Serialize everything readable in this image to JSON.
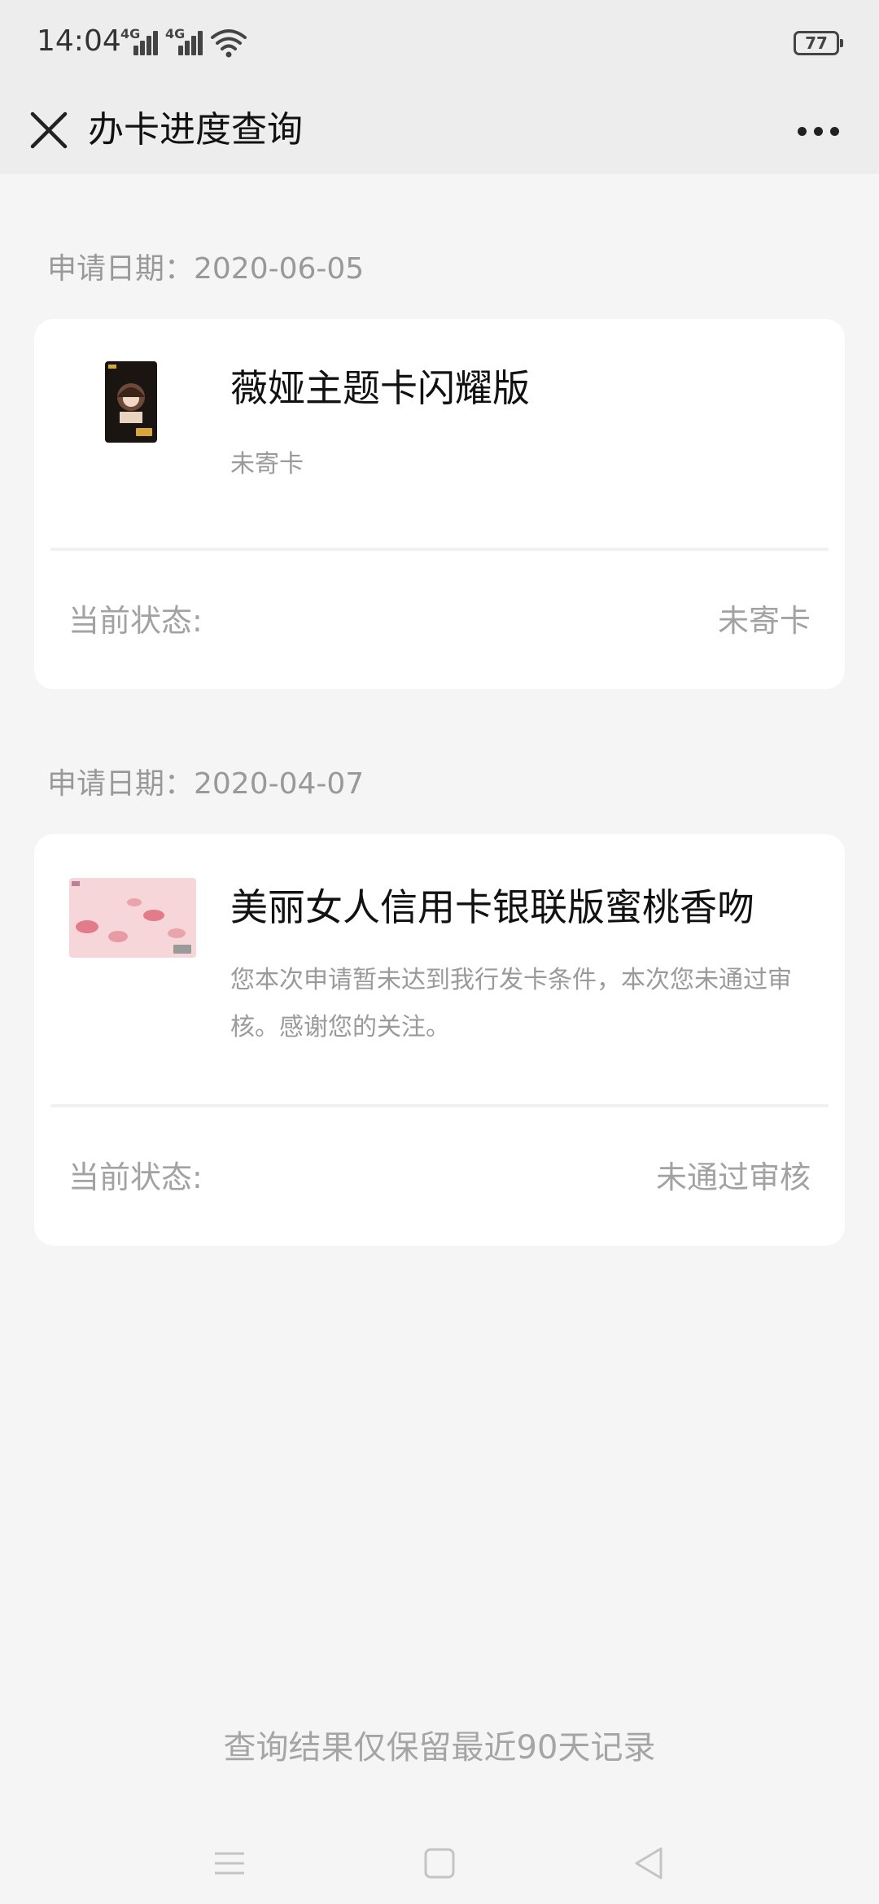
{
  "status_bar": {
    "time": "14:04",
    "network_1": "4G",
    "network_2": "4G",
    "battery": "77",
    "icons": [
      "signal-icon",
      "signal-icon",
      "wifi-icon",
      "battery-icon"
    ]
  },
  "header": {
    "title": "办卡进度查询",
    "close_icon": "close-icon",
    "more_icon": "more-icon"
  },
  "applications": [
    {
      "date_label": "申请日期：2020-06-05",
      "card_name": "薇娅主题卡闪耀版",
      "card_desc": "未寄卡",
      "status_label": "当前状态:",
      "status_value": "未寄卡"
    },
    {
      "date_label": "申请日期：2020-04-07",
      "card_name": "美丽女人信用卡银联版蜜桃香吻",
      "card_desc": "您本次申请暂未达到我行发卡条件，本次您未通过审核。感谢您的关注。",
      "status_label": "当前状态:",
      "status_value": "未通过审核"
    }
  ],
  "footer": {
    "note": "查询结果仅保留最近90天记录"
  },
  "nav_bar": {
    "icons": [
      "menu-icon",
      "home-icon",
      "back-icon"
    ]
  },
  "colors": {
    "header_bg": "#ededed",
    "page_bg": "#f5f5f5",
    "card_bg": "#ffffff",
    "muted_text": "#9a9a9a"
  }
}
